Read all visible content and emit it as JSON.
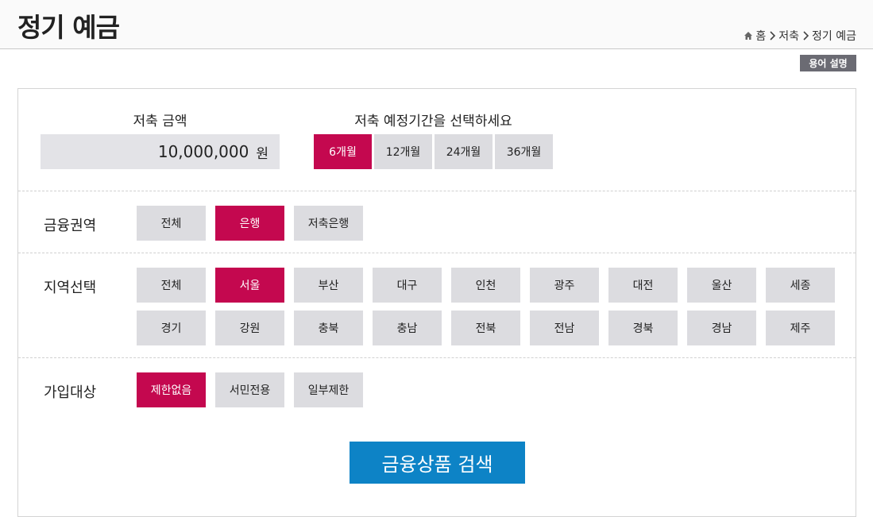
{
  "header": {
    "title": "정기 예금",
    "breadcrumb": [
      "홈",
      "저축",
      "정기 예금"
    ]
  },
  "term_button": "용어 설명",
  "amount": {
    "label": "저축 금액",
    "value": "10,000,000",
    "unit": "원"
  },
  "period": {
    "label": "저축 예정기간을 선택하세요",
    "options": [
      "6개월",
      "12개월",
      "24개월",
      "36개월"
    ],
    "selected": "6개월"
  },
  "sector": {
    "label": "금융권역",
    "options": [
      "전체",
      "은행",
      "저축은행"
    ],
    "selected": "은행"
  },
  "region": {
    "label": "지역선택",
    "options": [
      "전체",
      "서울",
      "부산",
      "대구",
      "인천",
      "광주",
      "대전",
      "울산",
      "세종",
      "경기",
      "강원",
      "충북",
      "충남",
      "전북",
      "전남",
      "경북",
      "경남",
      "제주"
    ],
    "selected": "서울"
  },
  "target": {
    "label": "가입대상",
    "options": [
      "제한없음",
      "서민전용",
      "일부제한"
    ],
    "selected": "제한없음"
  },
  "search_button": "금융상품 검색",
  "colors": {
    "accent": "#c4084f",
    "search": "#0d83c6",
    "button_bg": "#dcdce0"
  }
}
